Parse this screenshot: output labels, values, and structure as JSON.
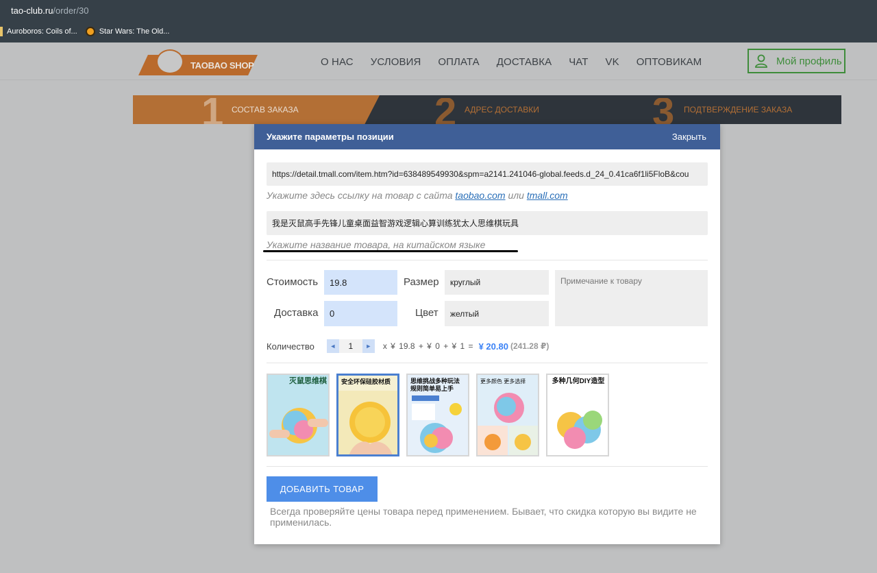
{
  "browser": {
    "url_host": "tao-club.ru",
    "url_path": "/order/30",
    "bookmarks": [
      "Auroboros: Coils of...",
      "Star Wars: The Old..."
    ]
  },
  "header": {
    "logo_text": "TAOBAO SHOP",
    "nav": [
      "О НАС",
      "УСЛОВИЯ",
      "ОПЛАТА",
      "ДОСТАВКА",
      "ЧАТ",
      "VK",
      "ОПТОВИКАМ"
    ],
    "profile_label": "Мой профиль"
  },
  "steps": [
    {
      "num": "1",
      "label": "СОСТАВ ЗАКАЗА"
    },
    {
      "num": "2",
      "label": "АДРЕС ДОСТАВКИ"
    },
    {
      "num": "3",
      "label": "ПОДТВЕРЖДЕНИЕ ЗАКАЗА"
    }
  ],
  "modal": {
    "title": "Укажите параметры позиции",
    "close_label": "Закрыть",
    "url_value": "https://detail.tmall.com/item.htm?id=638489549930&spm=a2141.241046-global.feeds.d_24_0.41ca6f1li5FloB&cou",
    "url_hint_prefix": "Укажите здесь ссылку на товар с сайта",
    "url_hint_link1": "taobao.com",
    "url_hint_or": "или",
    "url_hint_link2": "tmall.com",
    "name_value": "我是灭鼠高手先锋儿童桌面益智游戏逻辑心算训练犹太人思维棋玩具",
    "name_hint": "Укажите название товара, на китайском языке",
    "price_label": "Стоимость",
    "price_value": "19.8",
    "size_label": "Размер",
    "size_value": "круглый",
    "delivery_label": "Доставка",
    "delivery_value": "0",
    "color_label": "Цвет",
    "color_value": "желтый",
    "note_placeholder": "Примечание к товару",
    "qty_label": "Количество",
    "qty_value": "1",
    "calc_text": "x  ¥ 19.8  +  ¥ 0  +  ¥ 1  =",
    "total": "¥ 20.80",
    "total_rub": "(241.28 ₽)",
    "thumbnails": [
      {
        "caption": "灭鼠思维棋",
        "bg": "#bfe4ef"
      },
      {
        "caption": "安全环保硅胶材质",
        "bg": "#f3e9b9"
      },
      {
        "caption": "思维挑战多种玩法 规则简单易上手",
        "bg": "#e6f0fa"
      },
      {
        "caption": "更多颜色 更多选择",
        "bg": "#dfeef8"
      },
      {
        "caption": "多种几何DIY造型",
        "bg": "#ffffff"
      }
    ],
    "add_button": "ДОБАВИТЬ ТОВАР",
    "warning": "Всегда проверяйте цены товара перед применением. Бывает, что скидка которую вы видите не применилась."
  },
  "colors": {
    "modal_header": "#3f5f97",
    "accent_blue": "#4e8ee8",
    "profile_green": "#3e8c3a",
    "step_orange": "#b36f35"
  }
}
